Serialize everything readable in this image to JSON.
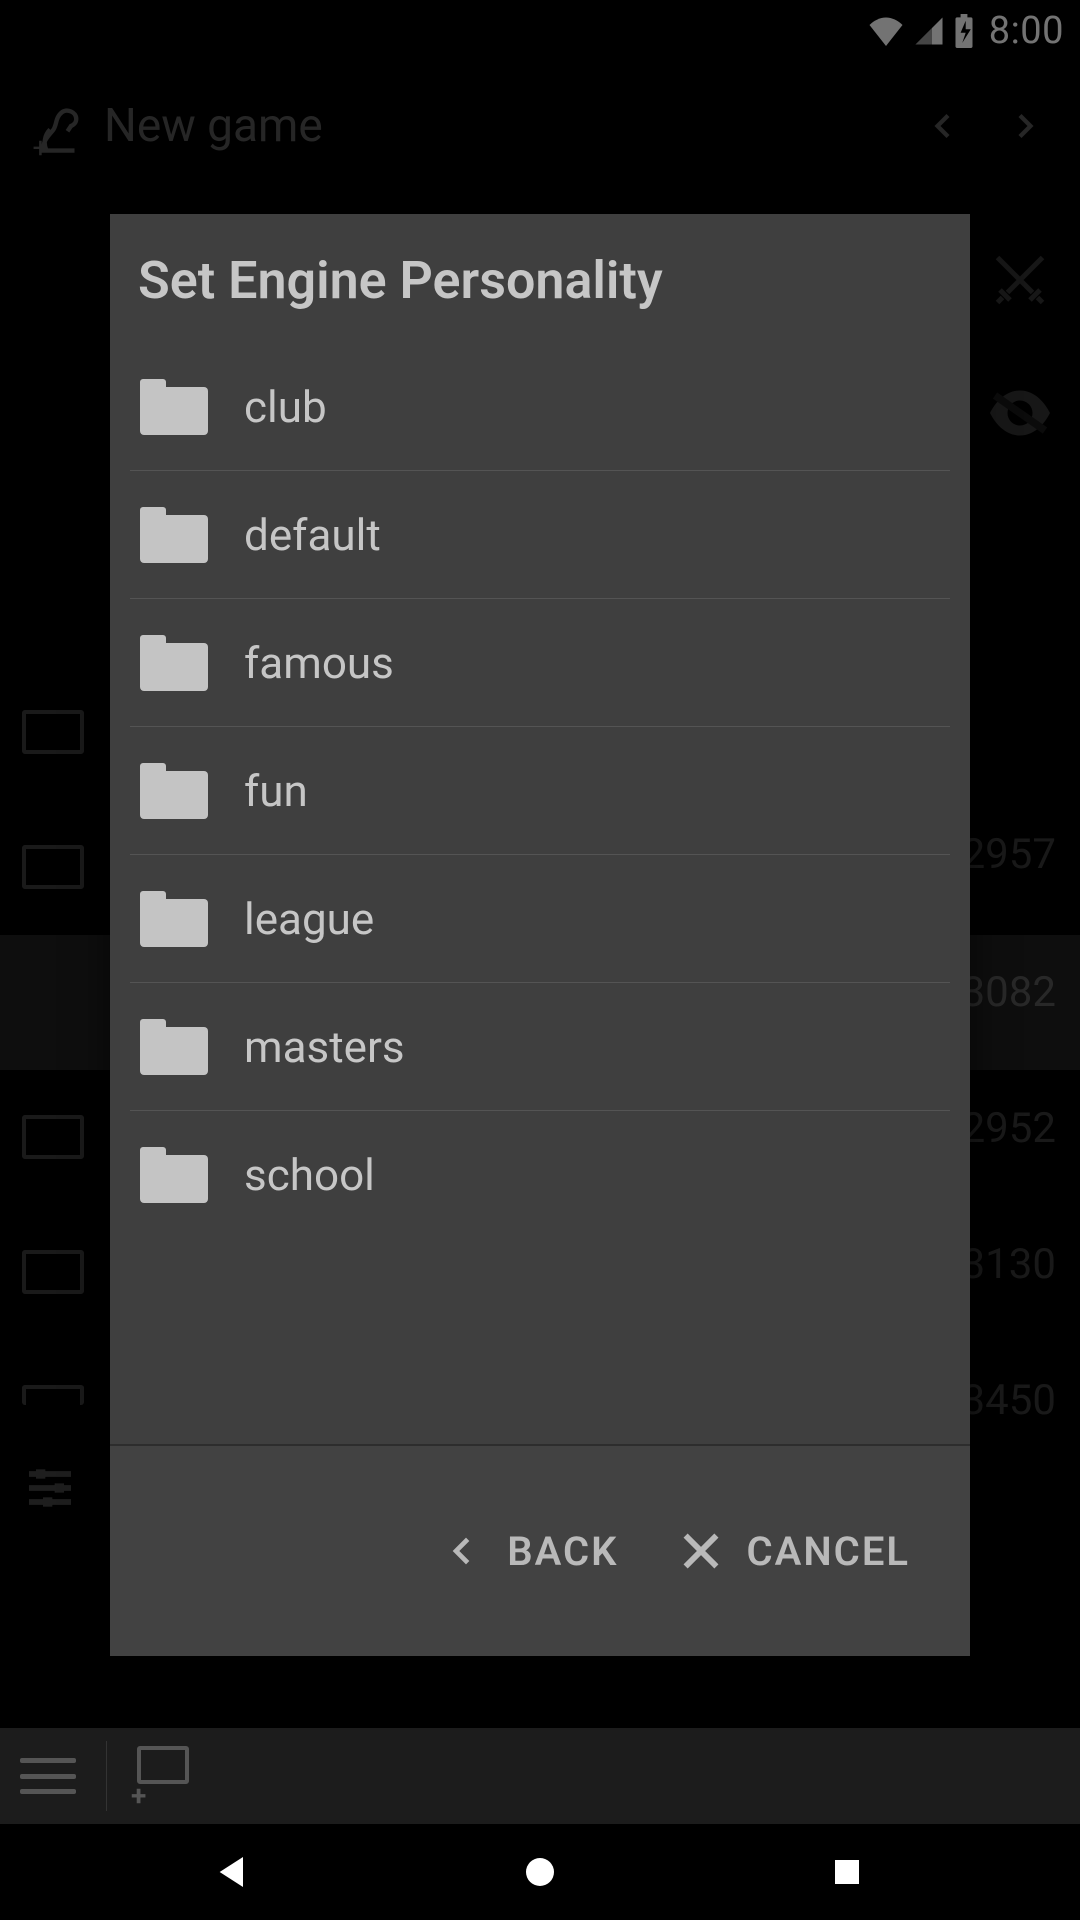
{
  "status_bar": {
    "time": "8:00"
  },
  "app_bar": {
    "title": "New game"
  },
  "background": {
    "numbers": [
      "2957",
      "3082",
      "2952",
      "3130",
      "3450"
    ]
  },
  "dialog": {
    "title": "Set Engine Personality",
    "items": [
      {
        "label": "club"
      },
      {
        "label": "default"
      },
      {
        "label": "famous"
      },
      {
        "label": "fun"
      },
      {
        "label": "league"
      },
      {
        "label": "masters"
      },
      {
        "label": "school"
      }
    ],
    "back_label": "BACK",
    "cancel_label": "CANCEL"
  }
}
